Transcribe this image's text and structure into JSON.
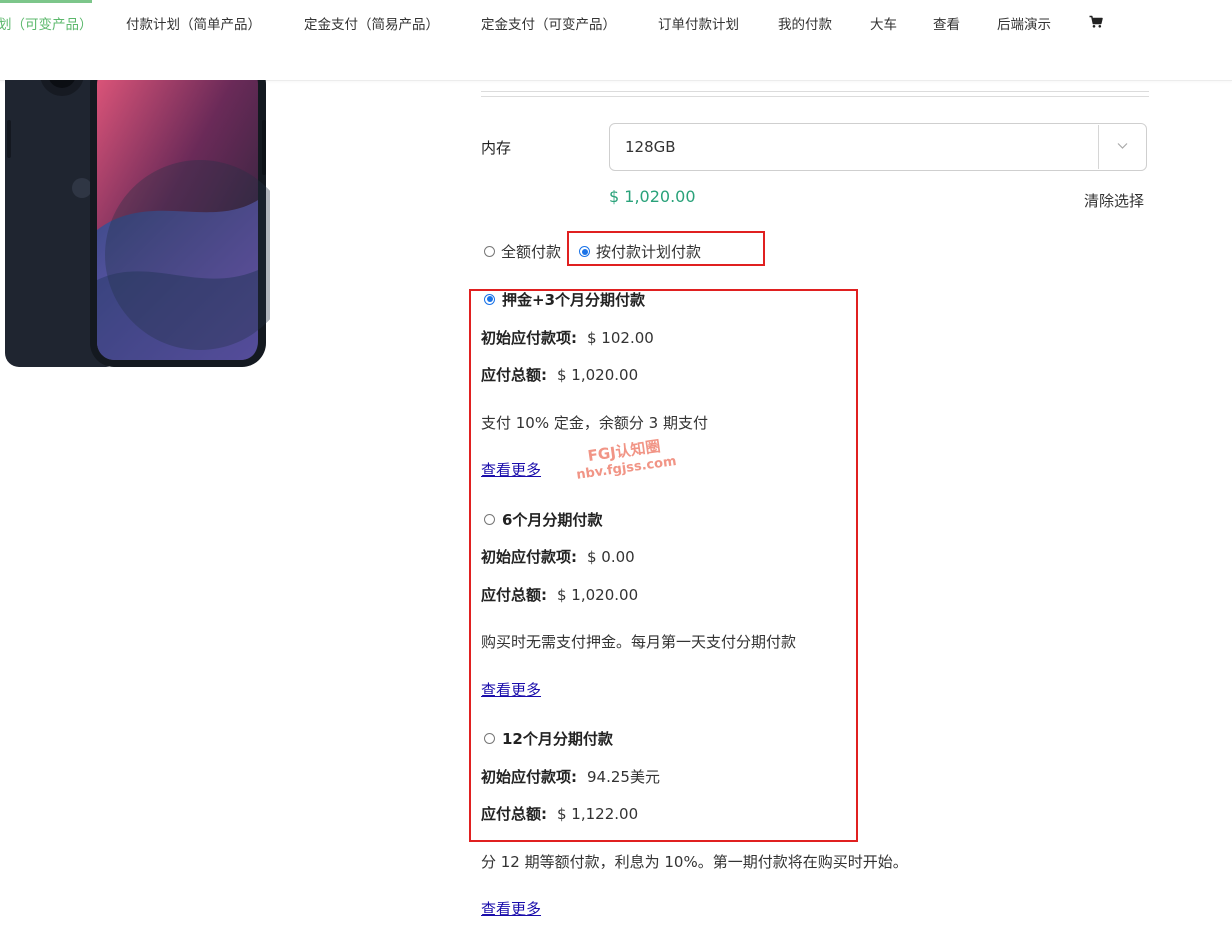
{
  "nav": {
    "items": [
      {
        "label": "划（可变产品）",
        "active": true
      },
      {
        "label": "付款计划（简单产品）"
      },
      {
        "label": "定金支付（简易产品）"
      },
      {
        "label": "定金支付（可变产品）"
      },
      {
        "label": "订单付款计划"
      },
      {
        "label": "我的付款"
      },
      {
        "label": "大车"
      },
      {
        "label": "查看"
      },
      {
        "label": "后端演示"
      }
    ],
    "cart_icon": "shopping-cart-icon",
    "active_color": "#5cb86c"
  },
  "product": {
    "image_icon": "phone-product-image",
    "memory_label": "内存",
    "memory_value": "128GB",
    "price": "$ 1,020.00",
    "price_color": "#2aa27a",
    "clear_label": "清除选择"
  },
  "payment_type": {
    "full_label": "全额付款",
    "plan_label": "按付款计划付款",
    "selected": "plan"
  },
  "plans": [
    {
      "title": "押金+3个月分期付款",
      "selected": true,
      "initial_label": "初始应付款项:",
      "initial_value": "$ 102.00",
      "total_label": "应付总额:",
      "total_value": "$ 1,020.00",
      "description": "支付 10% 定金，余额分 3 期支付",
      "more_label": "查看更多"
    },
    {
      "title": "6个月分期付款",
      "selected": false,
      "initial_label": "初始应付款项:",
      "initial_value": "$ 0.00",
      "total_label": "应付总额:",
      "total_value": "$ 1,020.00",
      "description": "购买时无需支付押金。每月第一天支付分期付款",
      "more_label": "查看更多"
    },
    {
      "title": "12个月分期付款",
      "selected": false,
      "initial_label": "初始应付款项:",
      "initial_value": "94.25美元",
      "total_label": "应付总额:",
      "total_value": "$ 1,122.00",
      "description": "分 12 期等额付款，利息为 10%。第一期付款将在购买时开始。",
      "more_label": "查看更多"
    }
  ],
  "annotations": {
    "highlight_color": "#e02020"
  },
  "watermark": {
    "line1": "FGJ认知圈",
    "line2": "nbv.fgjss.com"
  }
}
